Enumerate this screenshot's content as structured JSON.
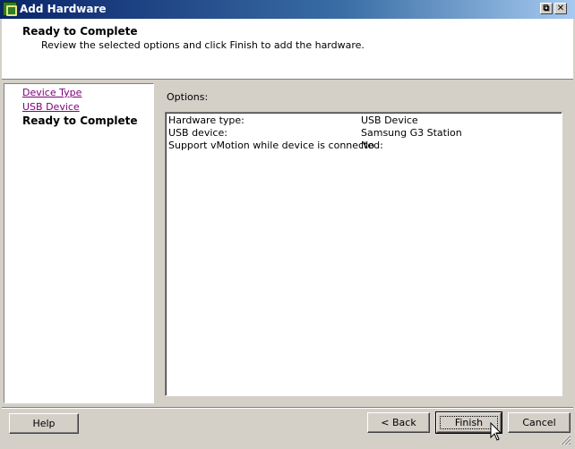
{
  "window": {
    "title": "Add Hardware",
    "controls": {
      "restore": "⧉",
      "close": "✕"
    }
  },
  "header": {
    "title": "Ready to Complete",
    "description": "Review the selected options and click Finish to add the hardware."
  },
  "nav": {
    "items": [
      {
        "label": "Device Type",
        "state": "visited-link"
      },
      {
        "label": "USB Device",
        "state": "visited-link"
      },
      {
        "label": "Ready to Complete",
        "state": "current"
      }
    ]
  },
  "options": {
    "label": "Options:",
    "rows": [
      {
        "label": "Hardware type:",
        "value": "USB Device"
      },
      {
        "label": "USB device:",
        "value": "Samsung G3 Station"
      },
      {
        "label": "Support vMotion while device is connected:",
        "value": "No"
      }
    ]
  },
  "buttons": {
    "help": "Help",
    "back": "< Back",
    "finish": "Finish",
    "cancel": "Cancel"
  },
  "colors": {
    "titlebar_start": "#0a246a",
    "titlebar_end": "#a6caf0",
    "visited_link": "#800080",
    "dialog_face": "#d4d0c8"
  }
}
